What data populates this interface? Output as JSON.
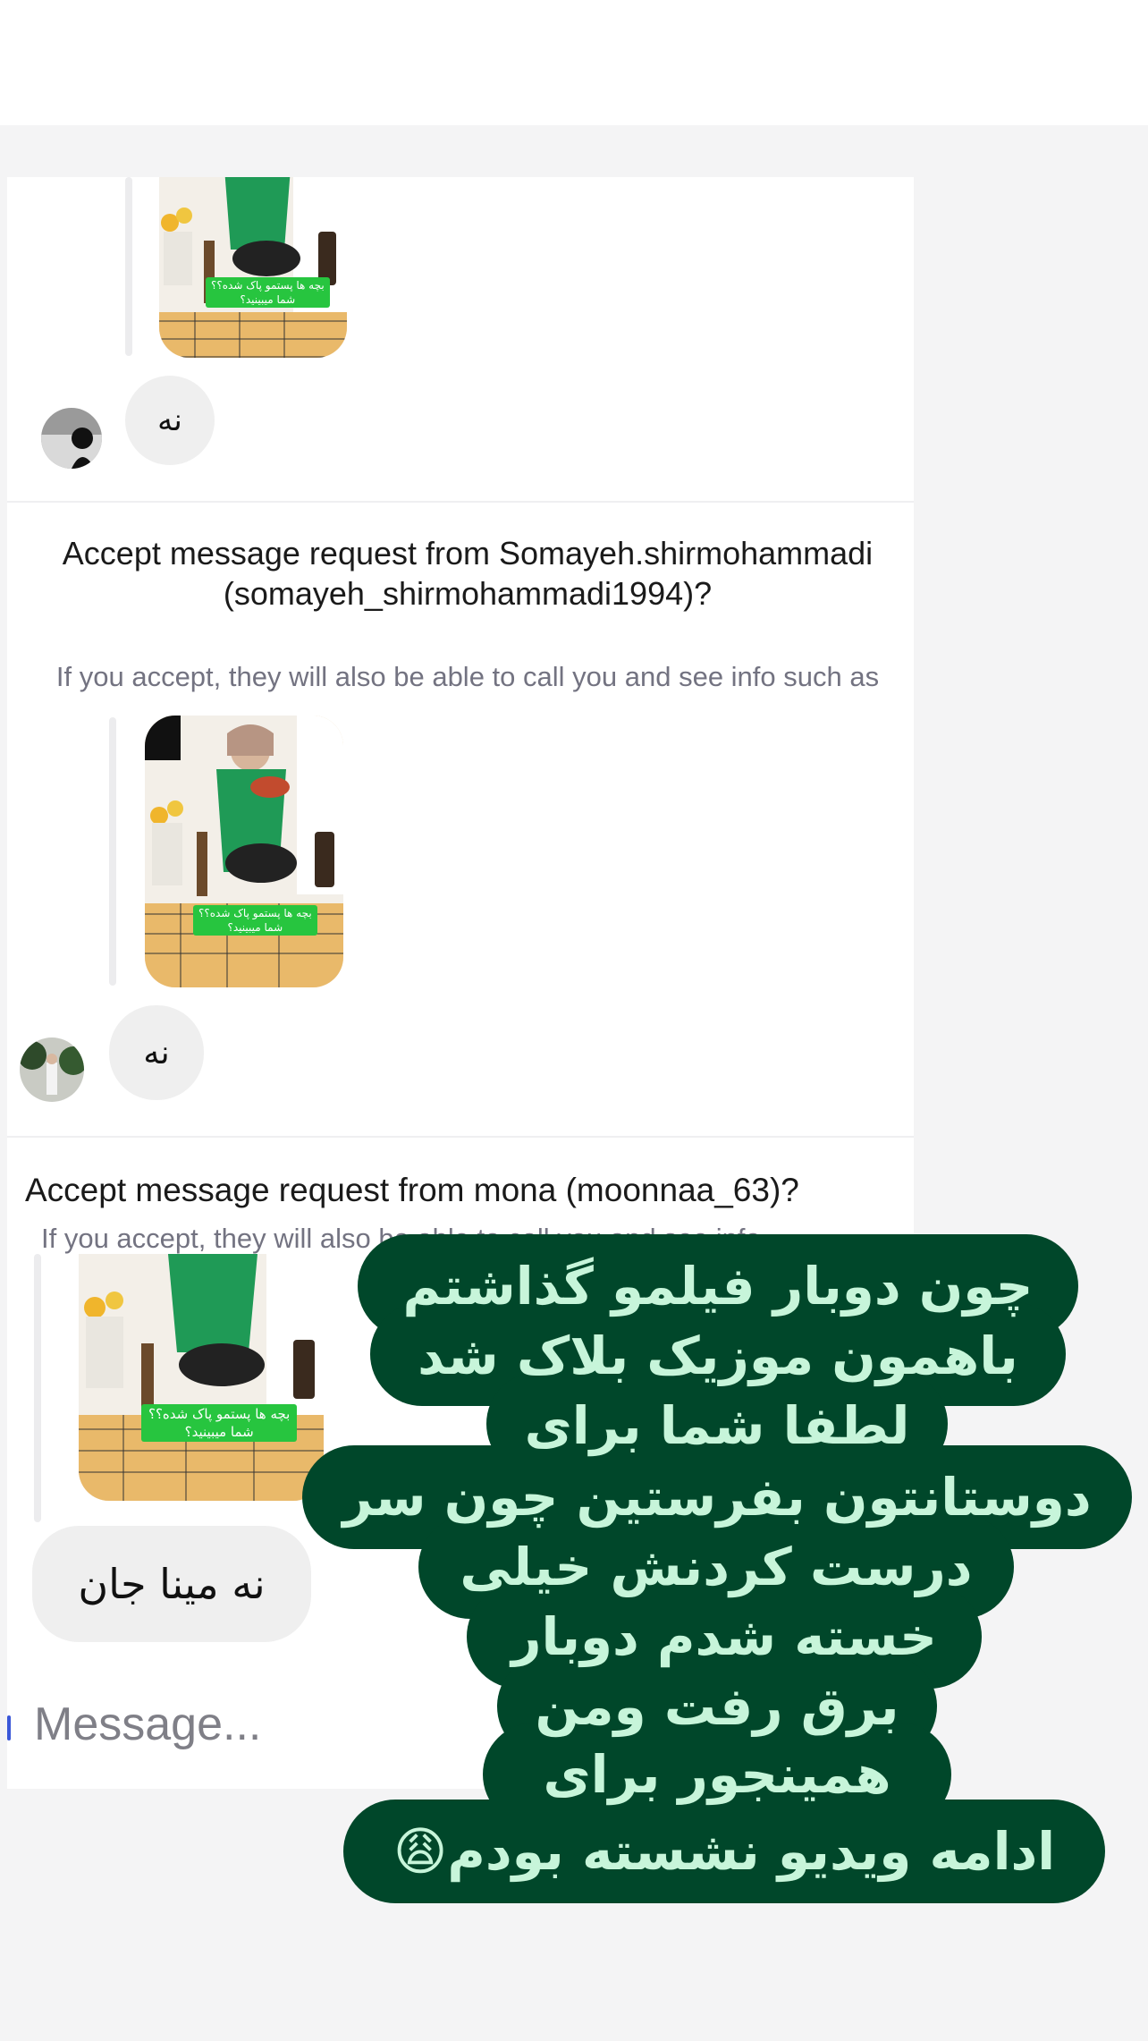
{
  "threads": [
    {
      "reply": "نه",
      "sticker": [
        "بچه ها پستمو پاک شده؟؟",
        "شما میبینید؟"
      ]
    },
    {
      "request_title": "Accept message request from Somayeh.shirmohammadi (somayeh_shirmohammadi1994)?",
      "request_subtitle": "If you accept, they will also be able to call you and see info such as your activity status and when you've read",
      "reply": "نه",
      "sticker": [
        "بچه ها پستمو پاک شده؟؟",
        "شما میبینید؟"
      ]
    },
    {
      "request_title": "Accept message request from mona (moonnaa_63)?",
      "request_subtitle": "If you accept, they will also be able to call you and see info",
      "reply": "نه مینا جان",
      "sticker": [
        "بچه ها پستمو پاک شده؟؟",
        "شما میبینید؟"
      ]
    }
  ],
  "composer": {
    "placeholder": "Message..."
  },
  "story_text": {
    "lines": [
      "چون دوبار فیلمو گذاشتم",
      "باهمون موزیک بلاک شد",
      "لطفا شما برای",
      "دوستانتون بفرستین چون سر",
      "درست کردنش خیلی",
      "خسته شدم دوبار",
      "برق رفت ومن",
      "همینجور برای",
      "ادامه ویدیو نشسته بودم😩"
    ]
  },
  "colors": {
    "overlay_bg": "#00472a",
    "overlay_text": "#c7f5da",
    "sticker_green": "#27c53f"
  }
}
